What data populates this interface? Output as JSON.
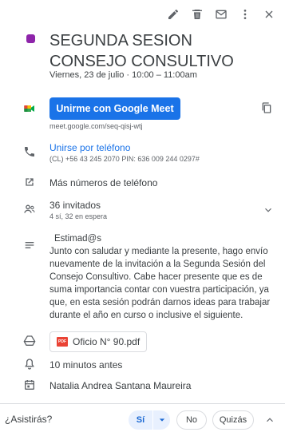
{
  "event": {
    "title": "SEGUNDA SESION CONSEJO CONSULTIVO",
    "datetime": "Viernes, 23 de julio  ·  10:00 – 11:00am",
    "color": "#8e24aa"
  },
  "toolbar": {
    "icons": [
      "edit-icon",
      "delete-icon",
      "email-icon",
      "more-icon",
      "close-icon"
    ]
  },
  "meet": {
    "button_label": "Unirme con Google Meet",
    "url": "meet.google.com/seq-qisj-wtj"
  },
  "phone": {
    "link_label": "Unirse por teléfono",
    "details": "(CL) +56 43 245 2070 PIN: 636 009 244 0297#",
    "more_numbers": "Más números de teléfono"
  },
  "guests": {
    "count_label": "36 invitados",
    "summary": "4 sí, 32 en espera"
  },
  "description": {
    "greeting": "Estimad@s",
    "body": "Junto con saludar y mediante la presente, hago envío nuevamente de la invitación a la Segunda Sesión del Consejo Consultivo. Cabe hacer presente que es de suma importancia contar con vuestra participación, ya que, en esta sesión podrán darnos ideas para trabajar durante el año en curso o inclusive el siguiente."
  },
  "attachment": {
    "name": "Oficio N° 90.pdf",
    "badge": "PDF"
  },
  "reminder": "10 minutos antes",
  "organizer": "Natalia Andrea Santana Maureira",
  "rsvp": {
    "question": "¿Asistirás?",
    "yes": "Sí",
    "no": "No",
    "maybe": "Quizás"
  },
  "colors": {
    "accent": "#1a73e8",
    "text": "#3c4043",
    "muted": "#5f6368"
  }
}
